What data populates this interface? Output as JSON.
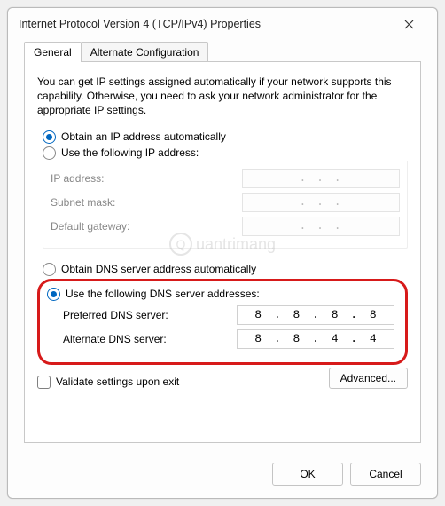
{
  "title": "Internet Protocol Version 4 (TCP/IPv4) Properties",
  "tabs": {
    "general": "General",
    "alternate": "Alternate Configuration"
  },
  "description": "You can get IP settings assigned automatically if your network supports this capability. Otherwise, you need to ask your network administrator for the appropriate IP settings.",
  "ip": {
    "auto": "Obtain an IP address automatically",
    "manual": "Use the following IP address:",
    "address_label": "IP address:",
    "subnet_label": "Subnet mask:",
    "gateway_label": "Default gateway:",
    "dots": ".       .       ."
  },
  "dns": {
    "auto": "Obtain DNS server address automatically",
    "manual": "Use the following DNS server addresses:",
    "preferred_label": "Preferred DNS server:",
    "alternate_label": "Alternate DNS server:",
    "preferred_value": "8 . 8 . 8 . 8",
    "alternate_value": "8 . 8 . 4 . 4"
  },
  "validate": "Validate settings upon exit",
  "advanced": "Advanced...",
  "ok": "OK",
  "cancel": "Cancel",
  "watermark": "uantrimang"
}
